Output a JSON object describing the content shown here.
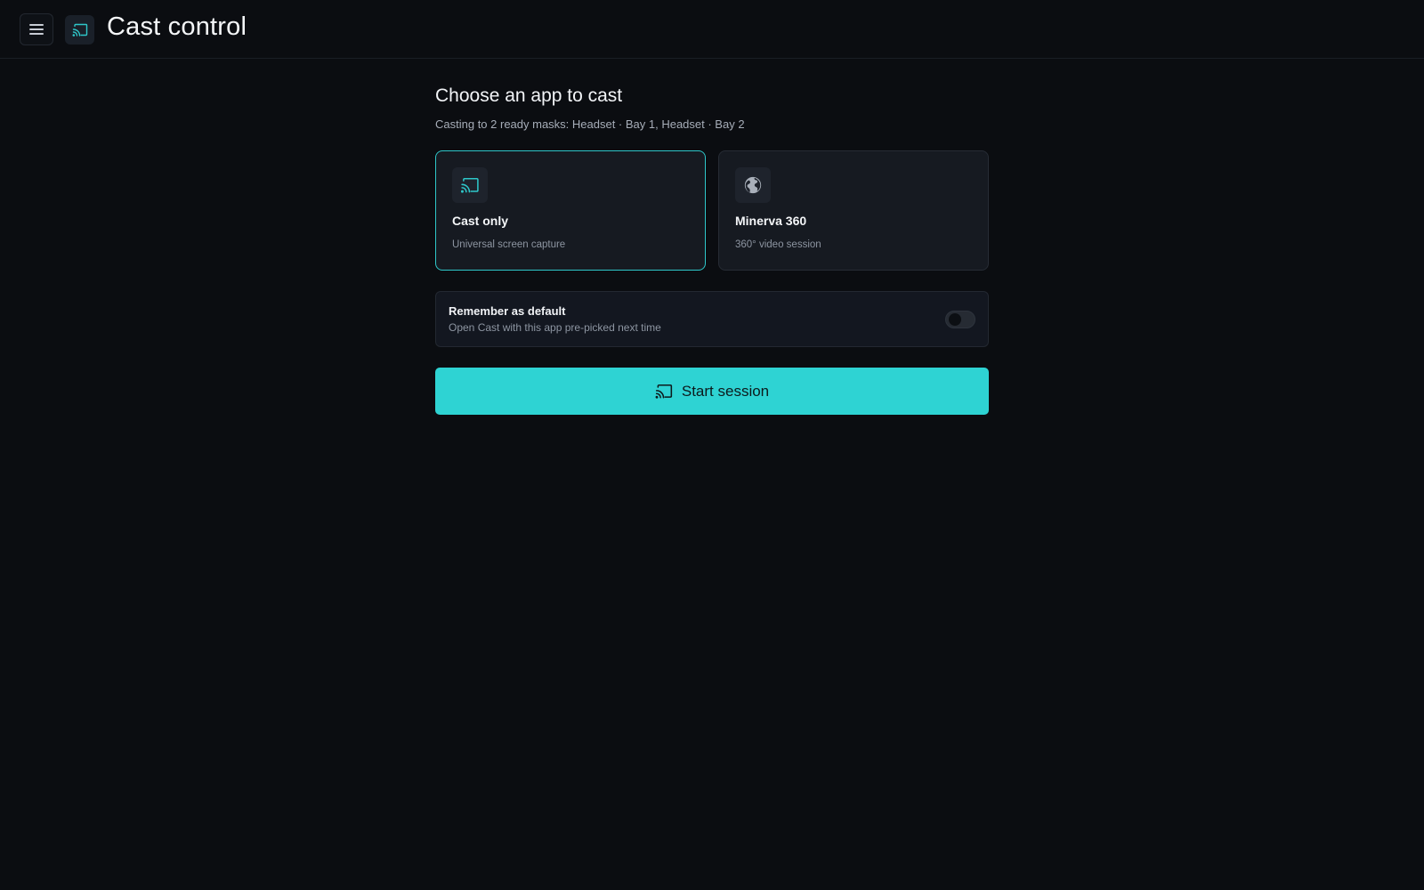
{
  "header": {
    "menu_icon": "hamburger-menu-icon",
    "logo_icon": "cast-icon",
    "title": "Cast control"
  },
  "main": {
    "heading": "Choose an app to cast",
    "subtext": "Casting to 2 ready masks: Headset · Bay 1, Headset · Bay 2",
    "apps": [
      {
        "icon": "cast-icon",
        "title": "Cast only",
        "description": "Universal screen capture",
        "selected": true
      },
      {
        "icon": "globe-icon",
        "title": "Minerva 360",
        "description": "360° video session",
        "selected": false
      }
    ],
    "remember": {
      "title": "Remember as default",
      "description": "Open Cast with this app pre-picked next time",
      "toggle_on": false
    },
    "start_button": {
      "icon": "cast-icon",
      "label": "Start session"
    }
  },
  "colors": {
    "accent": "#2ed3d3",
    "background": "#0b0d11",
    "card": "#161a21",
    "selected_border": "#2ec7c9"
  }
}
